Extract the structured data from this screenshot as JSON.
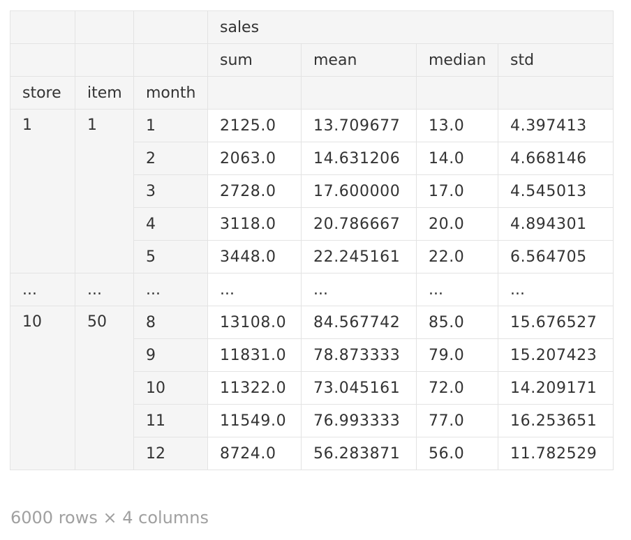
{
  "table": {
    "top_header": [
      "",
      "",
      "",
      "sales"
    ],
    "stat_headers": [
      "sum",
      "mean",
      "median",
      "std"
    ],
    "index_headers": [
      "store",
      "item",
      "month"
    ],
    "groups": [
      {
        "store": "1",
        "item": "1",
        "rows": [
          {
            "month": "1",
            "sum": "2125.0",
            "mean": "13.709677",
            "median": "13.0",
            "std": "4.397413"
          },
          {
            "month": "2",
            "sum": "2063.0",
            "mean": "14.631206",
            "median": "14.0",
            "std": "4.668146"
          },
          {
            "month": "3",
            "sum": "2728.0",
            "mean": "17.600000",
            "median": "17.0",
            "std": "4.545013"
          },
          {
            "month": "4",
            "sum": "3118.0",
            "mean": "20.786667",
            "median": "20.0",
            "std": "4.894301"
          },
          {
            "month": "5",
            "sum": "3448.0",
            "mean": "22.245161",
            "median": "22.0",
            "std": "6.564705"
          }
        ]
      },
      {
        "store": "10",
        "item": "50",
        "rows": [
          {
            "month": "8",
            "sum": "13108.0",
            "mean": "84.567742",
            "median": "85.0",
            "std": "15.676527"
          },
          {
            "month": "9",
            "sum": "11831.0",
            "mean": "78.873333",
            "median": "79.0",
            "std": "15.207423"
          },
          {
            "month": "10",
            "sum": "11322.0",
            "mean": "73.045161",
            "median": "72.0",
            "std": "14.209171"
          },
          {
            "month": "11",
            "sum": "11549.0",
            "mean": "76.993333",
            "median": "77.0",
            "std": "16.253651"
          },
          {
            "month": "12",
            "sum": "8724.0",
            "mean": "56.283871",
            "median": "56.0",
            "std": "11.782529"
          }
        ]
      }
    ],
    "ellipsis": "..."
  },
  "shape_text": "6000 rows × 4 columns"
}
